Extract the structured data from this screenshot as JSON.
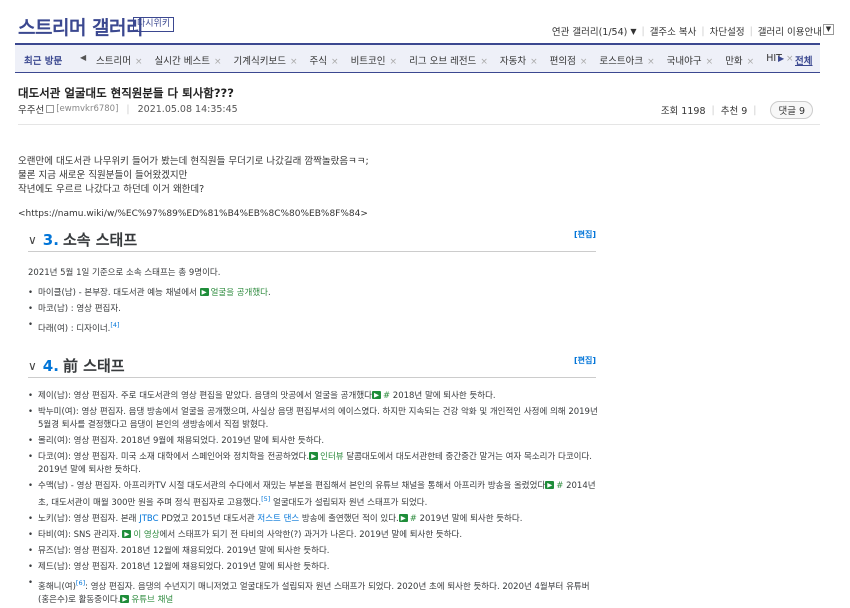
{
  "header": {
    "gallery_title": "스트리머 갤러리",
    "revisit_label": "다시위키",
    "related_gallery": "연관 갤러리(1/54)",
    "copy_address": "갤주소 복사",
    "block_settings": "차단설정",
    "gallery_guide": "갤러리 이용안내",
    "menu_icon": "chevron-down-icon"
  },
  "nav": {
    "recent_label": "최근 방문",
    "items": [
      "스트리머",
      "실시간 베스트",
      "기계식키보드",
      "주식",
      "비트코인",
      "리그 오브 레전드",
      "자동차",
      "편의점",
      "로스트아크",
      "국내야구",
      "만화",
      "HIT"
    ],
    "all_label": "전체"
  },
  "post": {
    "title": "대도서관 얼굴대도 현직원분들 다 퇴사함???",
    "author": "우주선",
    "uid": "[ewmvkr6780]",
    "date": "2021.05.08 14:35:45",
    "views": "조회 1198",
    "recommend": "추천 9",
    "comments": "댓글 9",
    "body_lines": [
      "오랜만에 대도서관 나무위키 들어가 봤는데 현직원들 무더기로 나갔길래 깜짝놀랐음ㅋㅋ;",
      "물론 지금 새로운 직원분들이 들어왔겠지만",
      "작년에도 우르르 나갔다고 하던데 이거 왜한데?"
    ],
    "url": "<https://namu.wiki/w/%EC%97%89%ED%81%B4%EB%8C%80%EB%8F%84>"
  },
  "wiki": {
    "edit_label": "[편집]",
    "s3": {
      "num": "3.",
      "title": "소속 스태프",
      "intro": "2021년 5월 1일 기준으로 소속 스태프는 총 9명이다.",
      "items": [
        {
          "a": "마이클(남) - 본부장. 대도서관 예능 채널에서 ",
          "link": "얼굴을 공개했다",
          "b": "."
        },
        {
          "a": "마코(남) : 영상 편집자.",
          "link": "",
          "b": ""
        },
        {
          "a": "다래(여) : 디자이너.",
          "sup": "[4]"
        }
      ]
    },
    "s4": {
      "num": "4.",
      "title": "前 스태프",
      "items": [
        {
          "a": "제이(남): 영상 편집자. 주로 대도서관의 영상 편집을 맡았다. 음댕의 맛공에서 얼굴을 공개했다",
          "link": "#",
          "b": " 2018년 말에 퇴사한 듯하다."
        },
        {
          "a": "박누미(여): 영상 편집자. 음댕 방송에서 얼굴을 공개했으며, 사실상 음댕 편집부서의 에이스였다. 하지만 지속되는 건강 악화 및 개인적인 사정에 의해 2019년 5월경 퇴사를 결정했다고 음댕이 본인의 생방송에서 직접 밝혔다."
        },
        {
          "a": "몰리(여): 영상 편집자. 2018년 9월에 채용되었다. 2019년 말에 퇴사한 듯하다."
        },
        {
          "a": "다코(여): 영상 편집자. 미국 소재 대학에서 스페인어와 정치학을 전공하였다.",
          "link": "인터뷰",
          "b": " 달콤대도에서 대도서관한테 중간중간 말거는 여자 목소리가 다코이다. 2019년 말에 퇴사한 듯하다."
        },
        {
          "a": "수맥(남) - 영상 편집자. 아프리카TV 시절 대도서관의 수다에서 재밌는 부분을 편집해서 본인의 유튜브 채널을 통해서 아프리카 방송을 올렸었다",
          "link": "#",
          "b": " 2014년 초, 대도서관이 매월 300만 원을 주며 정식 편집자로 고용했다.",
          "sup": "[5]",
          "c": " 얼굴대도가 설립되자 원년 스태프가 되었다."
        },
        {
          "a": "노키(남): 영상 편집자. 본래 ",
          "wlink1": "JTBC",
          "m": " PD였고 2015년 대도서관 ",
          "wlink2": "저스트 댄스",
          "n": " 방송에 출연했던 적이 있다.",
          "link": "#",
          "b": " 2019년 말에 퇴사한 듯하다."
        },
        {
          "a": "타비(여): SNS 관리자. ",
          "link": "이 영상",
          "b": "에서 스태프가 되기 전 타비의 사악한(?) 과거가 나온다. 2019년 말에 퇴사한 듯하다."
        },
        {
          "a": "뮤즈(남): 영상 편집자. 2018년 12월에 채용되었다. 2019년 말에 퇴사한 듯하다."
        },
        {
          "a": "제드(남): 영상 편집자. 2018년 12월에 채용되었다. 2019년 말에 퇴사한 듯하다."
        },
        {
          "a": "홍해니(여)",
          "sup": "[6]",
          "c": ": 영상 편집자. 음댕의 수년지기 매니저였고 얼굴대도가 설립되자 원년 스태프가 되었다. 2020년 초에 퇴사한 듯하다. 2020년 4월부터 유튜버(홍은수)로 활동중이다.",
          "link": "유튜브 채널",
          "b": ""
        }
      ]
    }
  }
}
